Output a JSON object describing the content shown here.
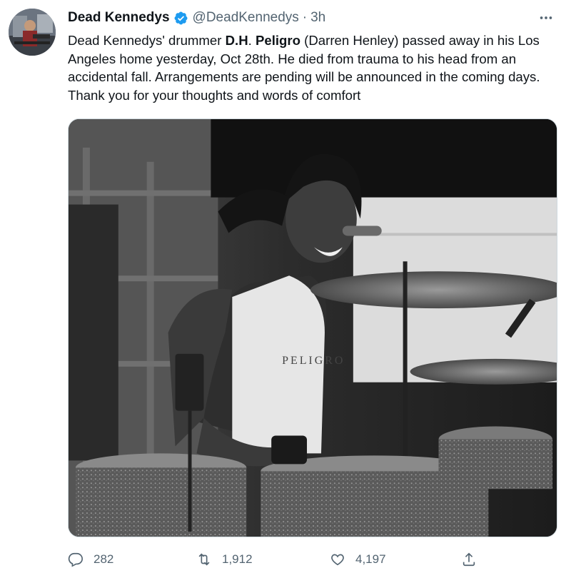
{
  "tweet": {
    "author": {
      "display_name": "Dead Kennedys",
      "handle": "@DeadKennedys",
      "verified": true,
      "avatar_icon": "user-avatar"
    },
    "separator": "·",
    "time": "3h",
    "text_parts": {
      "p1": "Dead Kennedys' drummer ",
      "bold1": "D.H",
      "p2": ". ",
      "bold2": "Peligro",
      "p3": " (Darren Henley) passed away in his Los Angeles home yesterday, Oct 28th. He died from trauma to his head from an accidental fall. Arrangements are pending will be announced in the coming days. Thank you for your thoughts and words of comfort"
    },
    "media": {
      "type": "photo",
      "shirt_text": "PELIGRO",
      "tone": "black-and-white"
    },
    "actions": {
      "reply": {
        "icon": "reply-icon",
        "count": "282"
      },
      "retweet": {
        "icon": "retweet-icon",
        "count": "1,912"
      },
      "like": {
        "icon": "heart-icon",
        "count": "4,197"
      },
      "share": {
        "icon": "share-icon"
      }
    },
    "more_icon": "more-horizontal-icon"
  },
  "colors": {
    "text_primary": "#0f1419",
    "text_secondary": "#536471",
    "verified_blue": "#1d9bf0"
  }
}
